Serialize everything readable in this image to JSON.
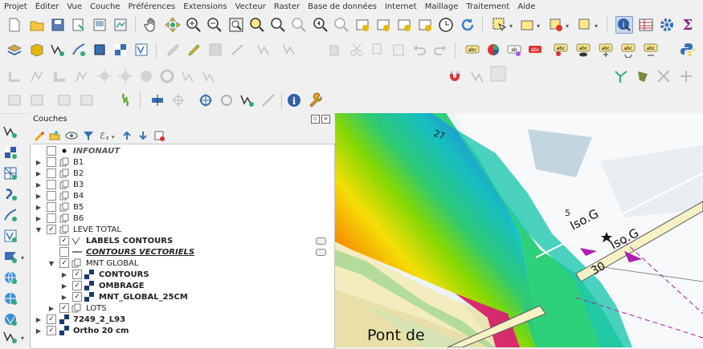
{
  "menu": [
    "Projet",
    "Éditer",
    "Vue",
    "Couche",
    "Préférences",
    "Extensions",
    "Vecteur",
    "Raster",
    "Base de données",
    "Internet",
    "Maillage",
    "Traitement",
    "Aide"
  ],
  "snapping": {
    "tolerance": "12",
    "unit": "px"
  },
  "layers_panel": {
    "title": "Couches",
    "rows": [
      {
        "label": "INFONAUT"
      },
      {
        "label": "B1"
      },
      {
        "label": "B2"
      },
      {
        "label": "B3"
      },
      {
        "label": "B4"
      },
      {
        "label": "B5"
      },
      {
        "label": "B6"
      },
      {
        "label": "LEVE TOTAL"
      },
      {
        "label": "LABELS CONTOURS"
      },
      {
        "label": "CONTOURS VECTORIELS"
      },
      {
        "label": "MNT GLOBAL"
      },
      {
        "label": "CONTOURS"
      },
      {
        "label": "OMBRAGE"
      },
      {
        "label": "MNT_GLOBAL_25CM"
      },
      {
        "label": "LOTS"
      },
      {
        "label": "7249_2_L93"
      },
      {
        "label": "Ortho 20 cm"
      }
    ]
  },
  "map_labels": {
    "depth_27": "27",
    "depth_5": "5",
    "buoy_a": "Iso.G",
    "buoy_b": "Iso.G",
    "depth_30": "30",
    "bridge": "Pont de"
  },
  "colors": {
    "accent": "#3c78d8",
    "panel_bg": "#f0f0f0"
  }
}
